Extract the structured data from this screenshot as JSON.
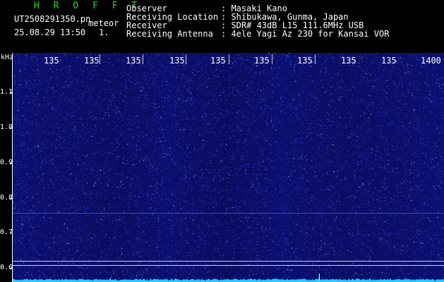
{
  "header": {
    "app_title": "H R O F F T",
    "filename": "UT2508291350.pn",
    "meteor_label": "meteor",
    "datetime": "25.08.29 13:50",
    "count": "1.",
    "info": [
      {
        "label": "Observer",
        "value": ": Masaki Kano"
      },
      {
        "label": "Receiving Location",
        "value": ": Shibukawa, Gunma, Japan"
      },
      {
        "label": "Receiver",
        "value": ": SDR# 43dB L15 111.6MHz USB"
      },
      {
        "label": "Receiving Antenna",
        "value": ": 4ele Yagi Az 230 for Kansai VOR"
      }
    ]
  },
  "axes": {
    "y_unit": "kHz",
    "y_ticks": [
      "1.1",
      "1.0",
      "0.9",
      "0.8",
      "0.7",
      "0.6"
    ],
    "x_ticks": [
      "135",
      "135",
      "135",
      "135",
      "135",
      "135",
      "135",
      "135",
      "135",
      "1400"
    ]
  },
  "colors": {
    "background": "#000000",
    "waterfall": "#0b0f6e",
    "noise": "#3f4bff",
    "trace": "#22ccff",
    "title": "#22dd22"
  }
}
